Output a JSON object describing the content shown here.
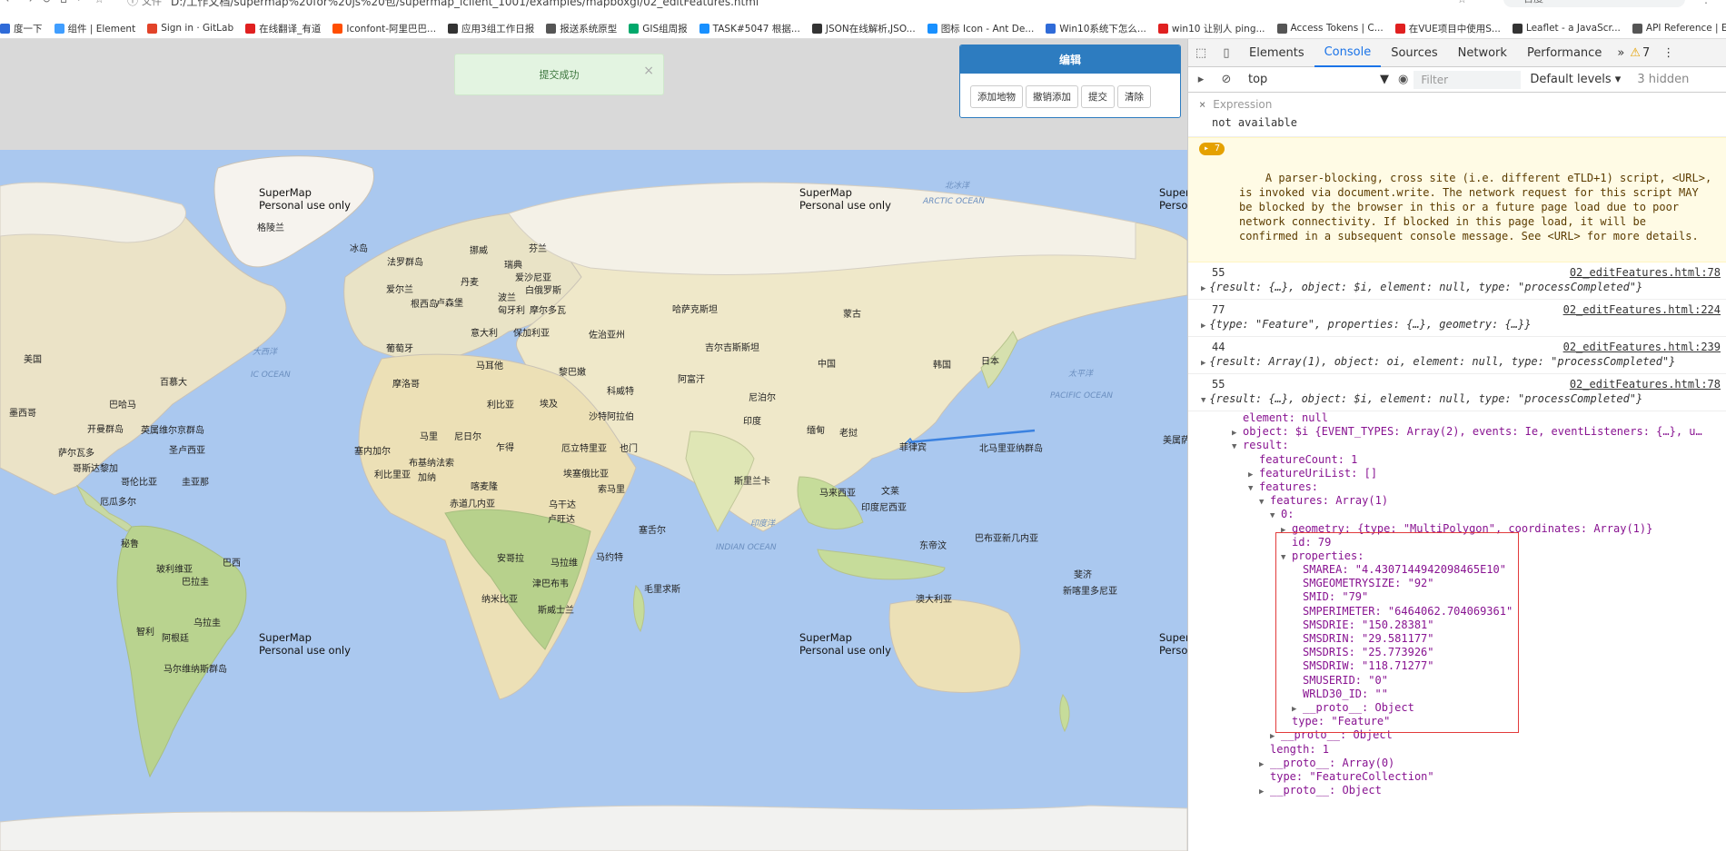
{
  "browser": {
    "url": "D:/工作文档/supermap%20for%20js%20包/supermap_iclient_1001/examples/mapboxgl/02_editFeatures.html",
    "url_prefix": "文件",
    "search_placeholder": "百度",
    "bookmarks": [
      {
        "label": "度一下",
        "color": "#2f6bd8"
      },
      {
        "label": "组件 | Element",
        "color": "#409eff"
      },
      {
        "label": "Sign in · GitLab",
        "color": "#e24329"
      },
      {
        "label": "在线翻译_有道",
        "color": "#e02020"
      },
      {
        "label": "Iconfont-阿里巴巴...",
        "color": "#ff4e00"
      },
      {
        "label": "应用3组工作日报",
        "color": "#333333"
      },
      {
        "label": "报送系统原型",
        "color": "#555555"
      },
      {
        "label": "GIS组周报",
        "color": "#00a86b"
      },
      {
        "label": "TASK#5047 根据...",
        "color": "#1890ff"
      },
      {
        "label": "JSON在线解析,JSO...",
        "color": "#333333"
      },
      {
        "label": "图标 Icon - Ant De...",
        "color": "#1890ff"
      },
      {
        "label": "Win10系统下怎么...",
        "color": "#2f6bd8"
      },
      {
        "label": "win10 让别人 ping...",
        "color": "#e02020"
      },
      {
        "label": "Access Tokens | C...",
        "color": "#555555"
      },
      {
        "label": "在VUE项目中使用S...",
        "color": "#e02020"
      },
      {
        "label": "Leaflet - a JavaScr...",
        "color": "#333333"
      },
      {
        "label": "API Reference | Es...",
        "color": "#555555"
      },
      {
        "label": "iclient for leaflet -...",
        "color": "#c00000"
      }
    ]
  },
  "page": {
    "toast": "提交成功",
    "toast_close": "×",
    "edit_panel": {
      "title": "编辑",
      "buttons": [
        "添加地物",
        "撤销添加",
        "提交",
        "清除"
      ]
    },
    "watermark_line1": "SuperMap",
    "watermark_line2": "Personal use only",
    "watermark_cut_1": "Super",
    "watermark_cut_2": "Perso",
    "map_labels": [
      {
        "t": "格陵兰",
        "c": "l1"
      },
      {
        "t": "冰岛",
        "c": "l2"
      },
      {
        "t": "法罗群岛",
        "c": "l3"
      },
      {
        "t": "挪威",
        "c": "l4"
      },
      {
        "t": "芬兰",
        "c": "l5"
      },
      {
        "t": "瑞典",
        "c": "l6"
      },
      {
        "t": "爱沙尼亚",
        "c": "l7"
      },
      {
        "t": "丹麦",
        "c": "l8"
      },
      {
        "t": "白俄罗斯",
        "c": "l9"
      },
      {
        "t": "爱尔兰",
        "c": "l10"
      },
      {
        "t": "波兰",
        "c": "l11"
      },
      {
        "t": "根西岛",
        "c": "l12"
      },
      {
        "t": "卢森堡",
        "c": "l13"
      },
      {
        "t": "匈牙利",
        "c": "l14"
      },
      {
        "t": "摩尔多瓦",
        "c": "l15"
      },
      {
        "t": "哈萨克斯坦",
        "c": "l16"
      },
      {
        "t": "蒙古",
        "c": "l17"
      },
      {
        "t": "意大利",
        "c": "l18"
      },
      {
        "t": "保加利亚",
        "c": "l19"
      },
      {
        "t": "佐治亚州",
        "c": "l20"
      },
      {
        "t": "葡萄牙",
        "c": "l21"
      },
      {
        "t": "吉尔吉斯斯坦",
        "c": "l22"
      },
      {
        "t": "美国",
        "c": "l23"
      },
      {
        "t": "马耳他",
        "c": "l24"
      },
      {
        "t": "黎巴嫩",
        "c": "l25"
      },
      {
        "t": "中国",
        "c": "l26"
      },
      {
        "t": "韩国",
        "c": "l27"
      },
      {
        "t": "日本",
        "c": "l28"
      },
      {
        "t": "百慕大",
        "c": "l29"
      },
      {
        "t": "摩洛哥",
        "c": "l30"
      },
      {
        "t": "阿富汗",
        "c": "l31"
      },
      {
        "t": "科威特",
        "c": "l32"
      },
      {
        "t": "巴哈马",
        "c": "l33"
      },
      {
        "t": "利比亚",
        "c": "l34"
      },
      {
        "t": "埃及",
        "c": "l35"
      },
      {
        "t": "尼泊尔",
        "c": "l36"
      },
      {
        "t": "墨西哥",
        "c": "l37"
      },
      {
        "t": "沙特阿拉伯",
        "c": "l38"
      },
      {
        "t": "印度",
        "c": "l39"
      },
      {
        "t": "开曼群岛",
        "c": "l40"
      },
      {
        "t": "英属维尔京群岛",
        "c": "l41"
      },
      {
        "t": "缅甸",
        "c": "l42"
      },
      {
        "t": "马里",
        "c": "l43"
      },
      {
        "t": "尼日尔",
        "c": "l44"
      },
      {
        "t": "老挝",
        "c": "l45"
      },
      {
        "t": "萨尔瓦多",
        "c": "l46"
      },
      {
        "t": "圣卢西亚",
        "c": "l47"
      },
      {
        "t": "菲律宾",
        "c": "l48"
      },
      {
        "t": "北马里亚纳群岛",
        "c": "l49"
      },
      {
        "t": "美属萨",
        "c": "l50"
      },
      {
        "t": "塞内加尔",
        "c": "l51"
      },
      {
        "t": "布基纳法索",
        "c": "l52"
      },
      {
        "t": "乍得",
        "c": "l53"
      },
      {
        "t": "厄立特里亚",
        "c": "l54"
      },
      {
        "t": "也门",
        "c": "l55"
      },
      {
        "t": "哥斯达黎加",
        "c": "l56"
      },
      {
        "t": "加纳",
        "c": "l57"
      },
      {
        "t": "利比里亚",
        "c": "l58"
      },
      {
        "t": "埃塞俄比亚",
        "c": "l59"
      },
      {
        "t": "斯里兰卡",
        "c": "l60"
      },
      {
        "t": "哥伦比亚",
        "c": "l61"
      },
      {
        "t": "圭亚那",
        "c": "l62"
      },
      {
        "t": "喀麦隆",
        "c": "l63"
      },
      {
        "t": "索马里",
        "c": "l64"
      },
      {
        "t": "马来西亚",
        "c": "l65"
      },
      {
        "t": "文莱",
        "c": "l66"
      },
      {
        "t": "厄瓜多尔",
        "c": "l67"
      },
      {
        "t": "赤道几内亚",
        "c": "l68"
      },
      {
        "t": "乌干达",
        "c": "l69"
      },
      {
        "t": "印度尼西亚",
        "c": "l70"
      },
      {
        "t": "卢旺达",
        "c": "l71"
      },
      {
        "t": "塞舌尔",
        "c": "l72"
      },
      {
        "t": "巴布亚新几内亚",
        "c": "l73"
      },
      {
        "t": "秘鲁",
        "c": "l74"
      },
      {
        "t": "东帝汶",
        "c": "l75"
      },
      {
        "t": "巴西",
        "c": "l76"
      },
      {
        "t": "玻利维亚",
        "c": "l77"
      },
      {
        "t": "安哥拉",
        "c": "l78"
      },
      {
        "t": "马拉维",
        "c": "l79"
      },
      {
        "t": "马约特",
        "c": "l80"
      },
      {
        "t": "斐济",
        "c": "l81"
      },
      {
        "t": "巴拉圭",
        "c": "l82"
      },
      {
        "t": "津巴布韦",
        "c": "l83"
      },
      {
        "t": "毛里求斯",
        "c": "l84"
      },
      {
        "t": "新喀里多尼亚",
        "c": "l85"
      },
      {
        "t": "纳米比亚",
        "c": "l86"
      },
      {
        "t": "澳大利亚",
        "c": "l87"
      },
      {
        "t": "斯威士兰",
        "c": "l88"
      },
      {
        "t": "乌拉圭",
        "c": "l89"
      },
      {
        "t": "智利",
        "c": "l90"
      },
      {
        "t": "阿根廷",
        "c": "l91"
      },
      {
        "t": "马尔维纳斯群岛",
        "c": "l92"
      }
    ],
    "ocean_labels": [
      {
        "t": "北冰洋",
        "c": "o1"
      },
      {
        "t": "ARCTIC OCEAN",
        "c": "o2"
      },
      {
        "t": "大西洋",
        "c": "o3"
      },
      {
        "t": "IC OCEAN",
        "c": "o4"
      },
      {
        "t": "太平洋",
        "c": "o5"
      },
      {
        "t": "PACIFIC OCEAN",
        "c": "o6"
      },
      {
        "t": "印度洋",
        "c": "o7"
      },
      {
        "t": "INDIAN OCEAN",
        "c": "o8"
      }
    ]
  },
  "devtools": {
    "tabs": [
      "Elements",
      "Console",
      "Sources",
      "Network",
      "Performance"
    ],
    "active_tab": "Console",
    "more": "»",
    "warning_count": "7",
    "context": "top",
    "filter_placeholder": "Filter",
    "levels": "Default levels ▾",
    "hidden": "3 hidden",
    "expression_label": "Expression",
    "expression_value": "not available",
    "warning_badge": "▸ 7",
    "warning_text": "A parser-blocking, cross site (i.e. different eTLD+1) script, <URL>,\nis invoked via document.write. The network request for this script MAY\nbe blocked by the browser in this or a future page load due to poor\nnetwork connectivity. If blocked in this page load, it will be\nconfirmed in a subsequent console message. See <URL> for more details.",
    "entries": [
      {
        "num": "55",
        "src": "02_editFeatures.html:78",
        "line": "{result: {…}, object: $i, element: null, type: \"processCompleted\"}"
      },
      {
        "num": "77",
        "src": "02_editFeatures.html:224",
        "line": "{type: \"Feature\", properties: {…}, geometry: {…}}"
      },
      {
        "num": "44",
        "src": "02_editFeatures.html:239",
        "line": "{result: Array(1), object: oi, element: null, type: \"processCompleted\"}"
      },
      {
        "num": "55",
        "src": "02_editFeatures.html:78",
        "line": "{result: {…}, object: $i, element: null, type: \"processCompleted\"}"
      }
    ],
    "tree": [
      "element: null",
      "object: $i {EVENT_TYPES: Array(2), events: Ie, eventListeners: {…}, u…",
      "result:",
      "featureCount: 1",
      "featureUriList: []",
      "features:",
      "features: Array(1)",
      "0:",
      "geometry: {type: \"MultiPolygon\", coordinates: Array(1)}",
      "id: 79",
      "properties:",
      "SMAREA: \"4.4307144942098465E10\"",
      "SMGEOMETRYSIZE: \"92\"",
      "SMID: \"79\"",
      "SMPERIMETER: \"6464062.704069361\"",
      "SMSDRIE: \"150.28381\"",
      "SMSDRIN: \"29.581177\"",
      "SMSDRIS: \"25.773926\"",
      "SMSDRIW: \"118.71277\"",
      "SMUSERID: \"0\"",
      "WRLD30_ID: \"\"",
      "__proto__: Object",
      "type: \"Feature\"",
      "__proto__: Object",
      "length: 1",
      "__proto__: Array(0)",
      "type: \"FeatureCollection\"",
      "__proto__: Object"
    ]
  }
}
